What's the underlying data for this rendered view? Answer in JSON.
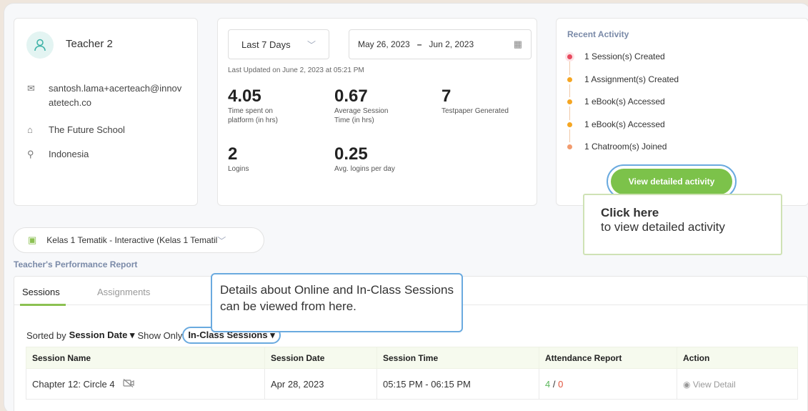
{
  "profile": {
    "name": "Teacher 2",
    "email": "santosh.lama+acerteach@innovatetech.co",
    "email_line1": "santosh.lama+acerteach@innov",
    "email_line2": "atetech.co",
    "school": "The Future School",
    "country": "Indonesia",
    "icons": [
      "user-icon",
      "mail-icon",
      "school-icon",
      "location-icon"
    ]
  },
  "stats": {
    "period": "Last 7 Days",
    "date_from": "May 26, 2023",
    "date_sep": "–",
    "date_to": "Jun 2, 2023",
    "last_updated": "Last Updated on June 2, 2023 at 05:21 PM",
    "items": [
      {
        "value": "4.05",
        "label1": "Time spent on",
        "label2": "platform (in hrs)"
      },
      {
        "value": "0.67",
        "label1": "Average Session",
        "label2": "Time (in hrs)"
      },
      {
        "value": "7",
        "label1": "Testpaper Generated",
        "label2": ""
      },
      {
        "value": "2",
        "label1": "Logins",
        "label2": ""
      },
      {
        "value": "0.25",
        "label1": "Avg. logins per day",
        "label2": ""
      }
    ]
  },
  "activity": {
    "title": "Recent Activity",
    "items": [
      {
        "label": "1 Session(s) Created",
        "color": "#e84a5f"
      },
      {
        "label": "1 Assignment(s) Created",
        "color": "#f5a623"
      },
      {
        "label": "1 eBook(s) Accessed",
        "color": "#f5a623"
      },
      {
        "label": "1 eBook(s) Accessed",
        "color": "#f5a623"
      },
      {
        "label": "1 Chatroom(s) Joined",
        "color": "#f29b6e"
      }
    ],
    "button": "View detailed activity"
  },
  "tooltip_activity": {
    "title": "Click here",
    "text": "to view detailed activity"
  },
  "class_selector": "Kelas 1 Tematik - Interactive (Kelas 1 Tematil",
  "report": {
    "title": "Teacher's Performance Report",
    "tabs": [
      "Sessions",
      "Assignments"
    ],
    "sort_prefix": "Sorted by",
    "sort_by": "Session Date ▾",
    "show_only_prefix": "Show Only",
    "show_only": "In-Class Sessions ▾",
    "columns": [
      "Session Name",
      "Session Date",
      "Session Time",
      "Attendance Report",
      "Action"
    ],
    "rows": [
      {
        "name": "Chapter 12: Circle 4",
        "date": "Apr 28, 2023",
        "time": "05:15 PM - 06:15 PM",
        "present": "4",
        "absent": "0",
        "action": "View Detail"
      }
    ]
  },
  "tooltip_sessions": "Details about Online and In-Class Sessions can be viewed from here.",
  "colors": {
    "accent_green": "#7cc24a",
    "highlight_blue": "#6aaadf",
    "label_blue": "#7a8aa8"
  }
}
